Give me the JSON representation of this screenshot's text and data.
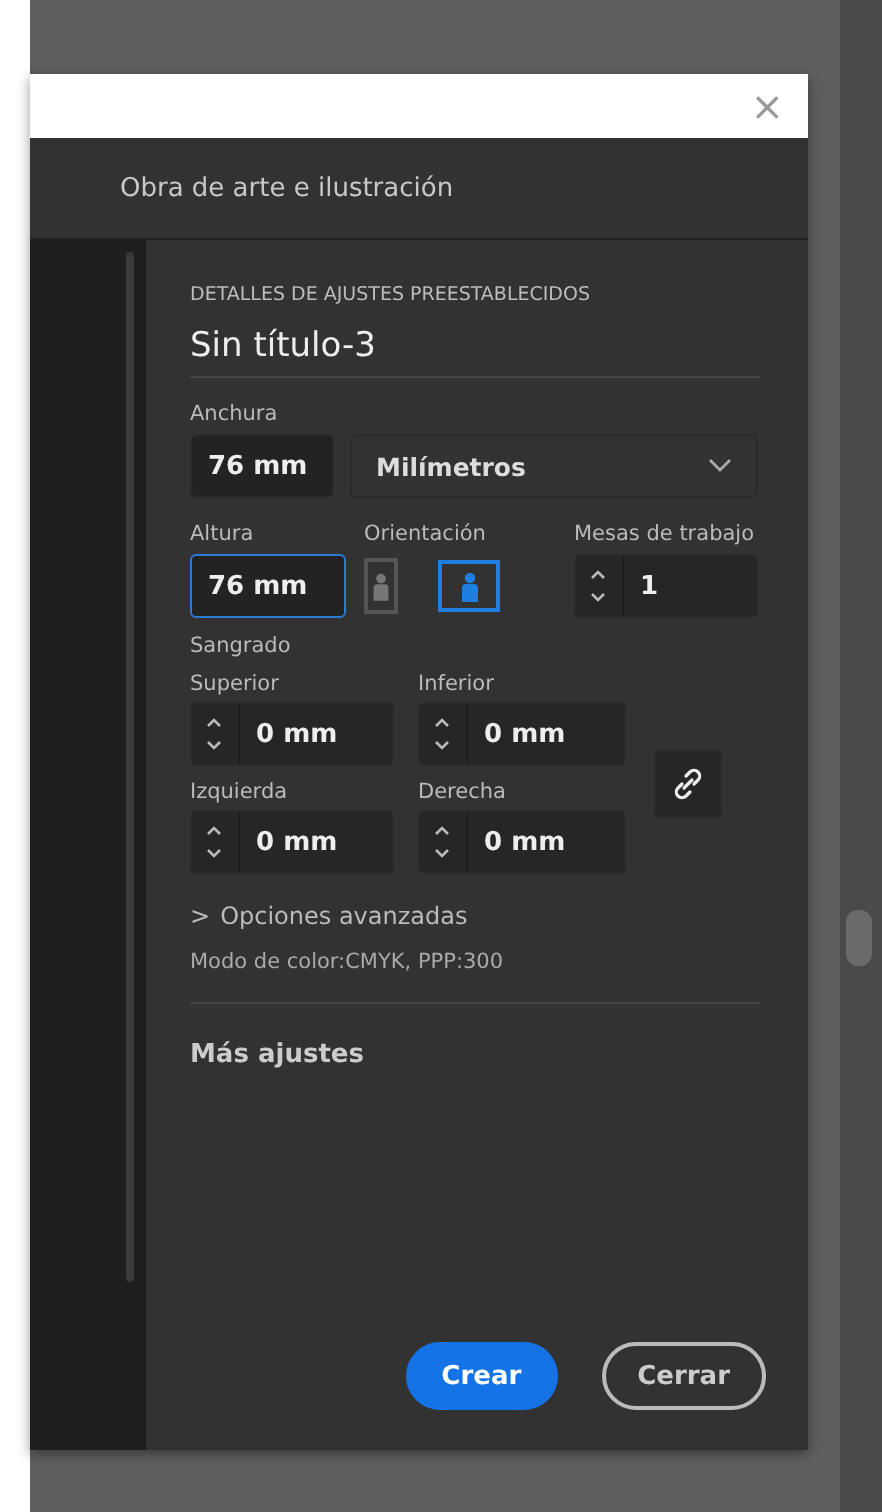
{
  "dialog": {
    "close": "×",
    "header_title": "Obra de arte e ilustración"
  },
  "preset": {
    "heading": "DETALLES DE AJUSTES PREESTABLECIDOS",
    "name": "Sin título-3",
    "width": {
      "label": "Anchura",
      "value": "76 mm",
      "focused": false
    },
    "units": {
      "value": "Milímetros"
    },
    "height": {
      "label": "Altura",
      "value": "76 mm",
      "focused": true
    },
    "orientation": {
      "label": "Orientación",
      "options": [
        {
          "kind": "portrait",
          "selected": false
        },
        {
          "kind": "landscape",
          "selected": true
        }
      ]
    },
    "artboards": {
      "label": "Mesas de trabajo",
      "value": "1"
    },
    "bleed": {
      "label": "Sangrado",
      "fields": [
        {
          "label": "Superior",
          "value": "0 mm"
        },
        {
          "label": "Inferior",
          "value": "0 mm"
        },
        {
          "label": "Izquierda",
          "value": "0 mm"
        },
        {
          "label": "Derecha",
          "value": "0 mm"
        }
      ]
    },
    "advanced": {
      "chevron": ">",
      "label": "Opciones avanzadas",
      "expanded": false
    },
    "color_info": "Modo de color:CMYK, PPP:300",
    "more": "Más ajustes"
  },
  "buttons": [
    {
      "label": "Crear",
      "kind": "primary"
    },
    {
      "label": "Cerrar",
      "kind": "secondary"
    }
  ]
}
